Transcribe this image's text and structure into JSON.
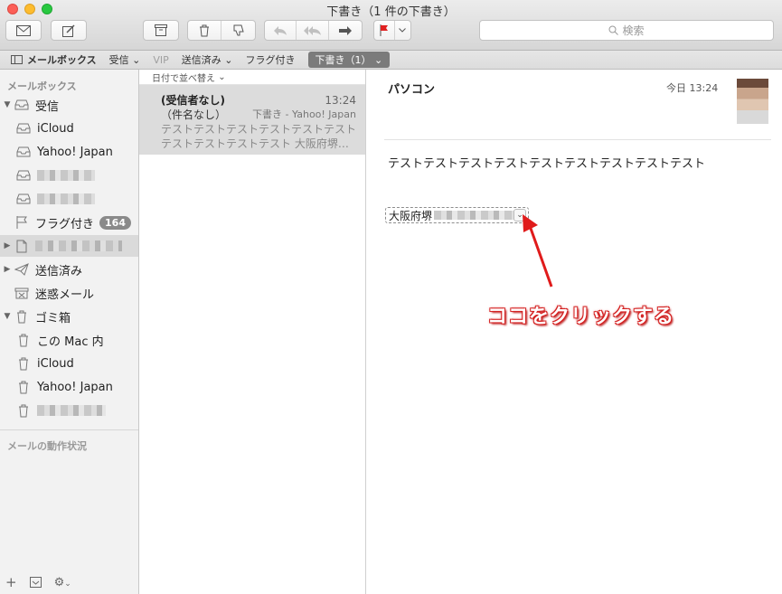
{
  "window": {
    "title": "下書き（1 件の下書き）"
  },
  "toolbar": {
    "search_placeholder": "検索"
  },
  "favorites": {
    "mailboxes_label": "メールボックス",
    "inbox_label": "受信",
    "vip_label": "VIP",
    "sent_label": "送信済み",
    "flagged_label": "フラグ付き",
    "drafts_label": "下書き（1）"
  },
  "sidebar": {
    "header": "メールボックス",
    "inbox": "受信",
    "icloud": "iCloud",
    "yahoo": "Yahoo! Japan",
    "flagged": "フラグ付き",
    "flagged_count": "164",
    "sent": "送信済み",
    "junk": "迷惑メール",
    "trash": "ゴミ箱",
    "trash_local": "この Mac 内",
    "trash_icloud": "iCloud",
    "trash_yahoo": "Yahoo! Japan",
    "status_header": "メールの動作状況"
  },
  "message_list": {
    "sort_label": "日付で並べ替え",
    "messages": [
      {
        "sender": "(受信者なし)",
        "time": "13:24",
        "subject": "（件名なし）",
        "account": "下書き - Yahoo! Japan",
        "preview1": "テストテストテストテストテストテスト",
        "preview2": "テストテストテストテスト 大阪府堺…"
      }
    ]
  },
  "preview": {
    "from": "パソコン",
    "date": "今日 13:24",
    "body": "テストテストテストテストテストテストテストテストテスト",
    "address_token": "大阪府堺",
    "callout": "ココをクリックする"
  },
  "colors": {
    "callout_red": "#d42222",
    "flag_red": "#e02020",
    "badge_gray": "#8a8a8a"
  }
}
